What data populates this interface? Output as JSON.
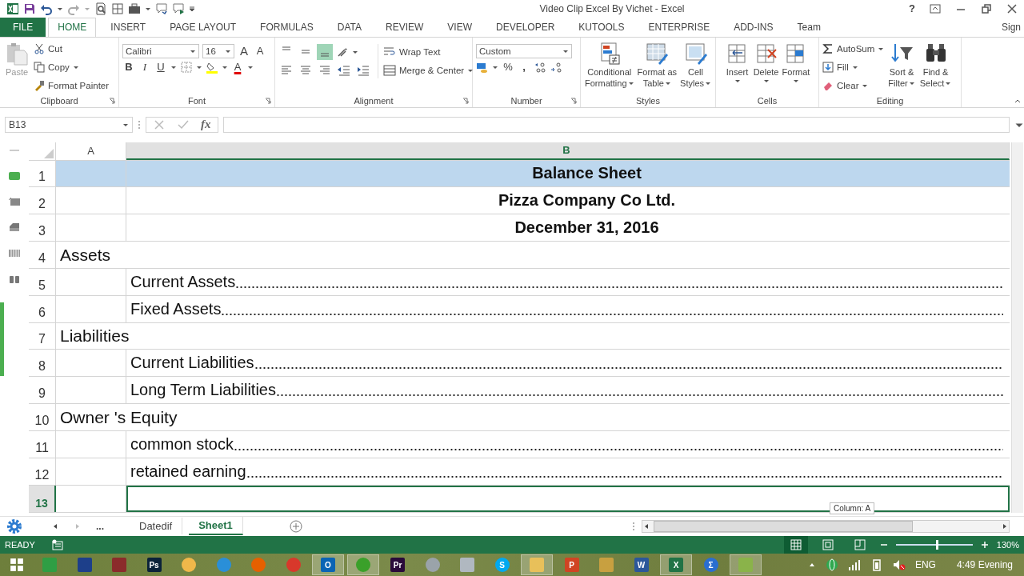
{
  "window": {
    "title": "Video Clip Excel By Vichet - Excel",
    "help": "?"
  },
  "ribbon_tabs": [
    {
      "label": "FILE",
      "kind": "file",
      "selected": false
    },
    {
      "label": "HOME",
      "kind": "tab",
      "selected": true
    },
    {
      "label": "INSERT",
      "kind": "tab",
      "selected": false
    },
    {
      "label": "PAGE LAYOUT",
      "kind": "tab",
      "selected": false
    },
    {
      "label": "FORMULAS",
      "kind": "tab",
      "selected": false
    },
    {
      "label": "DATA",
      "kind": "tab",
      "selected": false
    },
    {
      "label": "REVIEW",
      "kind": "tab",
      "selected": false
    },
    {
      "label": "VIEW",
      "kind": "tab",
      "selected": false
    },
    {
      "label": "DEVELOPER",
      "kind": "tab",
      "selected": false
    },
    {
      "label": "KUTOOLS",
      "kind": "tab",
      "selected": false
    },
    {
      "label": "ENTERPRISE",
      "kind": "tab",
      "selected": false
    },
    {
      "label": "ADD-INS",
      "kind": "tab",
      "selected": false
    },
    {
      "label": "Team",
      "kind": "tab",
      "selected": false
    }
  ],
  "account": "Sign",
  "ribbon": {
    "clipboard": {
      "paste": "Paste",
      "cut": "Cut",
      "copy": "Copy",
      "format_painter": "Format Painter",
      "label": "Clipboard"
    },
    "font": {
      "name": "Calibri",
      "size": "16",
      "grow": "A",
      "shrink": "A",
      "bold": "B",
      "italic": "I",
      "underline": "U",
      "color_button": "A",
      "label": "Font"
    },
    "alignment": {
      "vertical_align": [
        {
          "selected": false
        },
        {
          "selected": false
        },
        {
          "selected": true
        }
      ],
      "wrap": "Wrap Text",
      "merge": "Merge & Center",
      "label": "Alignment"
    },
    "number": {
      "format": "Custom",
      "percent": "%",
      "comma": ",",
      "label": "Number"
    },
    "styles": {
      "buttons": [
        {
          "lines": [
            "Conditional",
            "Formatting"
          ],
          "kind": "conditional"
        },
        {
          "lines": [
            "Format as",
            "Table"
          ],
          "kind": "table"
        },
        {
          "lines": [
            "Cell",
            "Styles"
          ],
          "kind": "cellstyles"
        }
      ],
      "label": "Styles"
    },
    "cells": {
      "buttons": [
        {
          "label": "Insert",
          "kind": "insert"
        },
        {
          "label": "Delete",
          "kind": "delete"
        },
        {
          "label": "Format",
          "kind": "format"
        }
      ],
      "label": "Cells"
    },
    "editing": {
      "autosum": "AutoSum",
      "fill": "Fill",
      "clear": "Clear",
      "buttons": [
        {
          "lines": [
            "Sort &",
            "Filter"
          ],
          "kind": "sort"
        },
        {
          "lines": [
            "Find &",
            "Select"
          ],
          "kind": "find"
        }
      ],
      "label": "Editing"
    }
  },
  "formula_bar": {
    "name_box": "B13",
    "fx": "fx"
  },
  "grid": {
    "columns": [
      {
        "label": "A",
        "selected": false
      },
      {
        "label": "B",
        "selected": true
      }
    ],
    "rows": [
      {
        "num": "1",
        "kind": "title",
        "text": "Balance Sheet",
        "highlighted": true,
        "selected": false
      },
      {
        "num": "2",
        "kind": "title",
        "text": "Pizza Company Co Ltd.",
        "highlighted": false,
        "selected": false
      },
      {
        "num": "3",
        "kind": "title",
        "text": "December 31, 2016",
        "highlighted": false,
        "selected": false
      },
      {
        "num": "4",
        "kind": "heading",
        "text": "Assets",
        "highlighted": false,
        "selected": false
      },
      {
        "num": "5",
        "kind": "item",
        "text": "Current Assets",
        "highlighted": false,
        "selected": false
      },
      {
        "num": "6",
        "kind": "item",
        "text": "Fixed Assets",
        "highlighted": false,
        "selected": false
      },
      {
        "num": "7",
        "kind": "heading",
        "text": "Liabilities",
        "highlighted": false,
        "selected": false
      },
      {
        "num": "8",
        "kind": "item",
        "text": "Current Liabilities",
        "highlighted": false,
        "selected": false
      },
      {
        "num": "9",
        "kind": "item",
        "text": "Long Term Liabilities",
        "highlighted": false,
        "selected": false
      },
      {
        "num": "10",
        "kind": "heading",
        "text": "Owner 's Equity",
        "highlighted": false,
        "selected": false
      },
      {
        "num": "11",
        "kind": "item",
        "text": "common stock",
        "highlighted": false,
        "selected": false
      },
      {
        "num": "12",
        "kind": "item",
        "text": "retained earning",
        "highlighted": false,
        "selected": false
      },
      {
        "num": "13",
        "kind": "empty",
        "highlighted": false,
        "selected": true
      }
    ]
  },
  "tooltip": "Column: A",
  "sheet_tabs": {
    "more": "...",
    "tabs": [
      {
        "label": "Datedif",
        "selected": false
      },
      {
        "label": "Sheet1",
        "selected": true
      }
    ]
  },
  "status_bar": {
    "status": "READY",
    "views": [
      {
        "selected": true
      },
      {
        "selected": false
      },
      {
        "selected": false
      }
    ],
    "zoom": {
      "level": 0.53,
      "reading": "130%"
    }
  },
  "taskbar": {
    "apps": [
      {
        "kind": "tile",
        "color": "#2f9e44",
        "active": false
      },
      {
        "kind": "tile",
        "color": "#1d3f8a",
        "active": false
      },
      {
        "kind": "tile",
        "color": "#8b2b2b",
        "active": false
      },
      {
        "kind": "tile",
        "color": "#0b2239",
        "glyph": "Ps",
        "active": false
      },
      {
        "kind": "round",
        "color": "#f0b84a",
        "active": false
      },
      {
        "kind": "round",
        "color": "#2a8fd8",
        "active": false
      },
      {
        "kind": "round",
        "color": "#e66000",
        "active": false
      },
      {
        "kind": "round",
        "color": "#d8382b",
        "active": false
      },
      {
        "kind": "tile",
        "color": "#0a64b4",
        "glyph": "O",
        "active": true
      },
      {
        "kind": "round",
        "color": "#3aa02a",
        "active": true
      },
      {
        "kind": "tile",
        "color": "#2a0a3a",
        "glyph": "Pr",
        "active": false
      },
      {
        "kind": "round",
        "color": "#9aa3aa",
        "active": false
      },
      {
        "kind": "tile",
        "color": "#b0b8c0",
        "active": false
      },
      {
        "kind": "round",
        "color": "#00a9f0",
        "glyph": "S",
        "active": false
      },
      {
        "kind": "tile",
        "color": "#e8c05a",
        "active": true
      },
      {
        "kind": "tile",
        "color": "#d04423",
        "glyph": "P",
        "active": false
      },
      {
        "kind": "tile",
        "color": "#c8a040",
        "active": false
      },
      {
        "kind": "tile",
        "color": "#2b579a",
        "glyph": "W",
        "active": false
      },
      {
        "kind": "tile",
        "color": "#217346",
        "glyph": "X",
        "active": true
      },
      {
        "kind": "round",
        "color": "#2a6ed0",
        "glyph": "Σ",
        "active": false
      },
      {
        "kind": "tile",
        "color": "#8ab34a",
        "active": true
      }
    ],
    "language": "ENG",
    "clock": "4:49 Evening"
  }
}
